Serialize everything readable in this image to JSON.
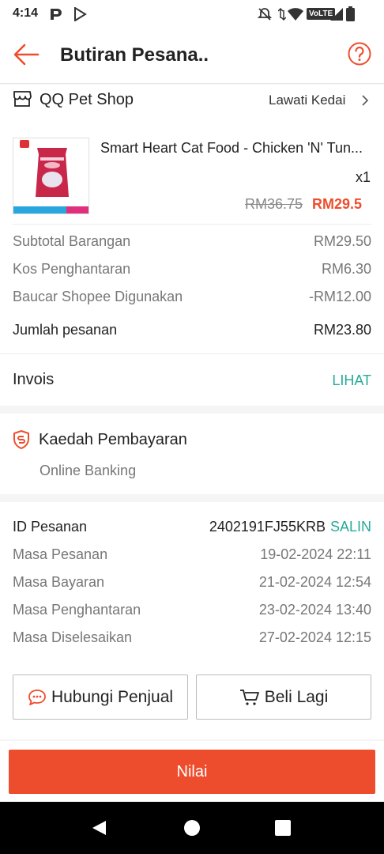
{
  "status_bar": {
    "time": "4:14",
    "network_label": "VoLTE"
  },
  "header": {
    "title": "Butiran Pesana.."
  },
  "shop": {
    "name": "QQ Pet Shop",
    "visit_label": "Lawati Kedai"
  },
  "product": {
    "name": "Smart Heart Cat Food - Chicken 'N' Tun...",
    "quantity": "x1",
    "original_price": "RM36.75",
    "price": "RM29.5"
  },
  "summary": {
    "rows": [
      {
        "label": "Subtotal Barangan",
        "value": "RM29.50"
      },
      {
        "label": "Kos Penghantaran",
        "value": "RM6.30"
      },
      {
        "label": "Baucar Shopee Digunakan",
        "value": "-RM12.00"
      }
    ],
    "total_label": "Jumlah pesanan",
    "total_value": "RM23.80"
  },
  "invoice": {
    "label": "Invois",
    "action": "LIHAT"
  },
  "payment": {
    "title": "Kaedah Pembayaran",
    "method": "Online Banking"
  },
  "order_info": {
    "id_label": "ID Pesanan",
    "id_value": "2402191FJ55KRB",
    "copy_label": "SALIN",
    "rows": [
      {
        "label": "Masa Pesanan",
        "value": "19-02-2024 22:11"
      },
      {
        "label": "Masa Bayaran",
        "value": "21-02-2024 12:54"
      },
      {
        "label": "Masa Penghantaran",
        "value": "23-02-2024 13:40"
      },
      {
        "label": "Masa Diselesaikan",
        "value": "27-02-2024 12:15"
      }
    ]
  },
  "actions": {
    "contact_label": "Hubungi Penjual",
    "buy_again_label": "Beli Lagi"
  },
  "bottom": {
    "rate_label": "Nilai"
  },
  "colors": {
    "accent": "#ee4d2d",
    "green": "#26aa99",
    "muted": "#777777"
  }
}
